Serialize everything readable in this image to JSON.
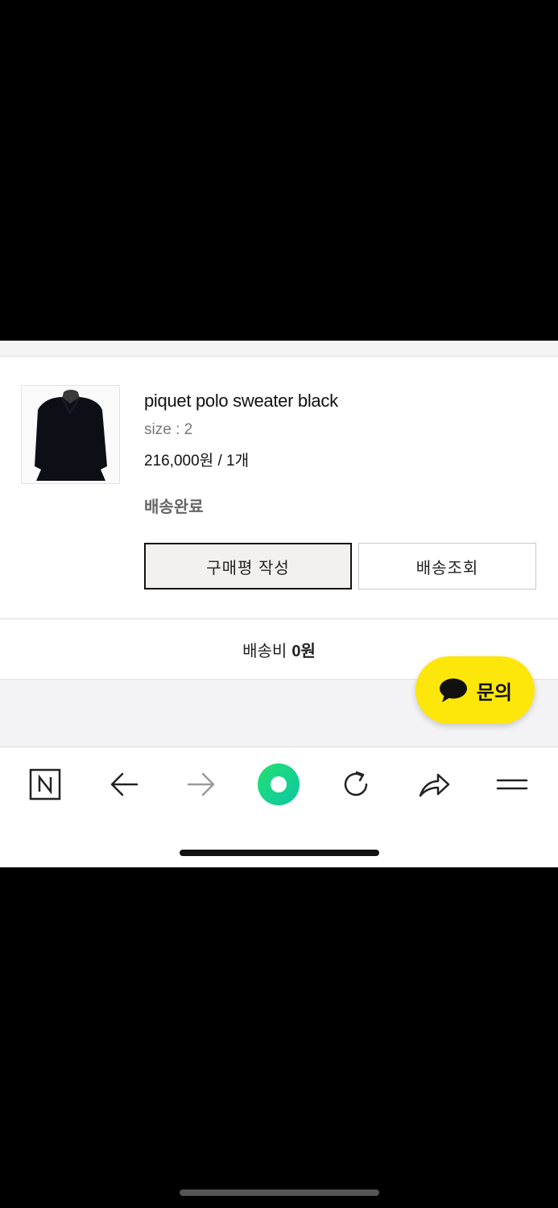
{
  "order": {
    "product_name": "piquet polo sweater black",
    "option": "size : 2",
    "price": "216,000원 / 1개",
    "status": "배송완료",
    "thumbnail_icon": "black-polo-sweater-image"
  },
  "actions": {
    "review_label": "구매평 작성",
    "track_label": "배송조회"
  },
  "shipping": {
    "label": "배송비",
    "value": "0원"
  },
  "chat_button": {
    "label": "문의",
    "icon": "chat-bubble-icon",
    "color": "#fde60a"
  },
  "browser_toolbar": {
    "items": [
      "naver-n-icon",
      "back-arrow-icon",
      "forward-arrow-icon",
      "green-home-icon",
      "reload-icon",
      "share-icon",
      "menu-icon"
    ],
    "accent": "#14d87a"
  }
}
